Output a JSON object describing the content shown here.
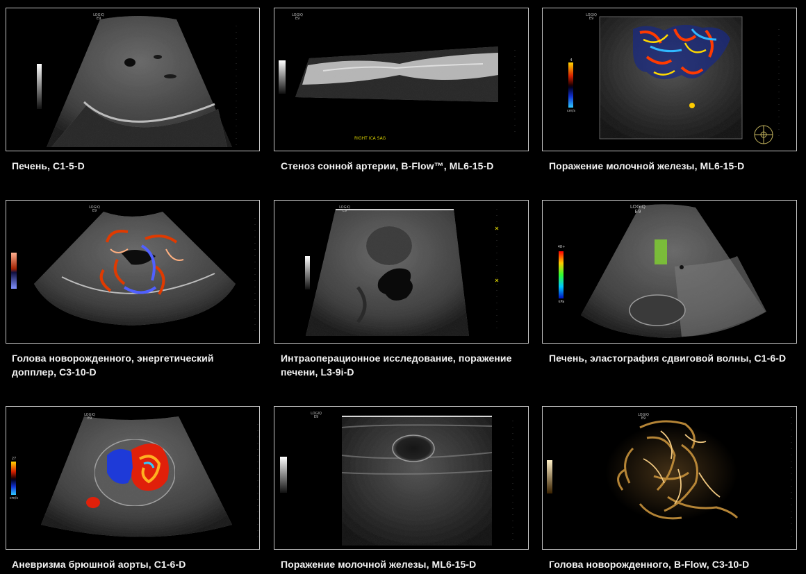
{
  "brand": {
    "line1": "LOGIQ",
    "line2": "E9"
  },
  "colors": {
    "background": "#000000",
    "caption": "#f2f2f2",
    "tile_border": "#c8c8c8",
    "marker": "#d8d000"
  },
  "tiles": [
    {
      "caption": "Печень, C1-5-D",
      "overlay": "",
      "scale_top": "",
      "scale_bottom": ""
    },
    {
      "caption": "Стеноз сонной артерии, B-Flow™, ML6-15-D",
      "overlay": "RIGHT ICA SAG",
      "scale_top": "",
      "scale_bottom": ""
    },
    {
      "caption": "Поражение молочной железы, ML6-15-D",
      "overlay": "",
      "scale_top": "4",
      "scale_bottom": "cm/s"
    },
    {
      "caption": "Голова новорожденного, энергетический допплер, C3-10-D",
      "overlay": "",
      "scale_top": "",
      "scale_bottom": ""
    },
    {
      "caption": "Интраоперационное исследование, поражение печени, L3-9i-D",
      "overlay": "",
      "scale_top": "",
      "scale_bottom": ""
    },
    {
      "caption": "Печень, эластография сдвиговой волны, C1-6-D",
      "overlay": "",
      "scale_top": "48+",
      "scale_bottom": "kPa"
    },
    {
      "caption": "Аневризма брюшной аорты, C1-6-D",
      "overlay": "",
      "scale_top": "27",
      "scale_bottom": "cm/s"
    },
    {
      "caption": "Поражение молочной железы, ML6-15-D",
      "overlay": "",
      "scale_top": "",
      "scale_bottom": ""
    },
    {
      "caption": "Голова новорожденного, B-Flow, C3-10-D",
      "overlay": "",
      "scale_top": "",
      "scale_bottom": ""
    }
  ]
}
